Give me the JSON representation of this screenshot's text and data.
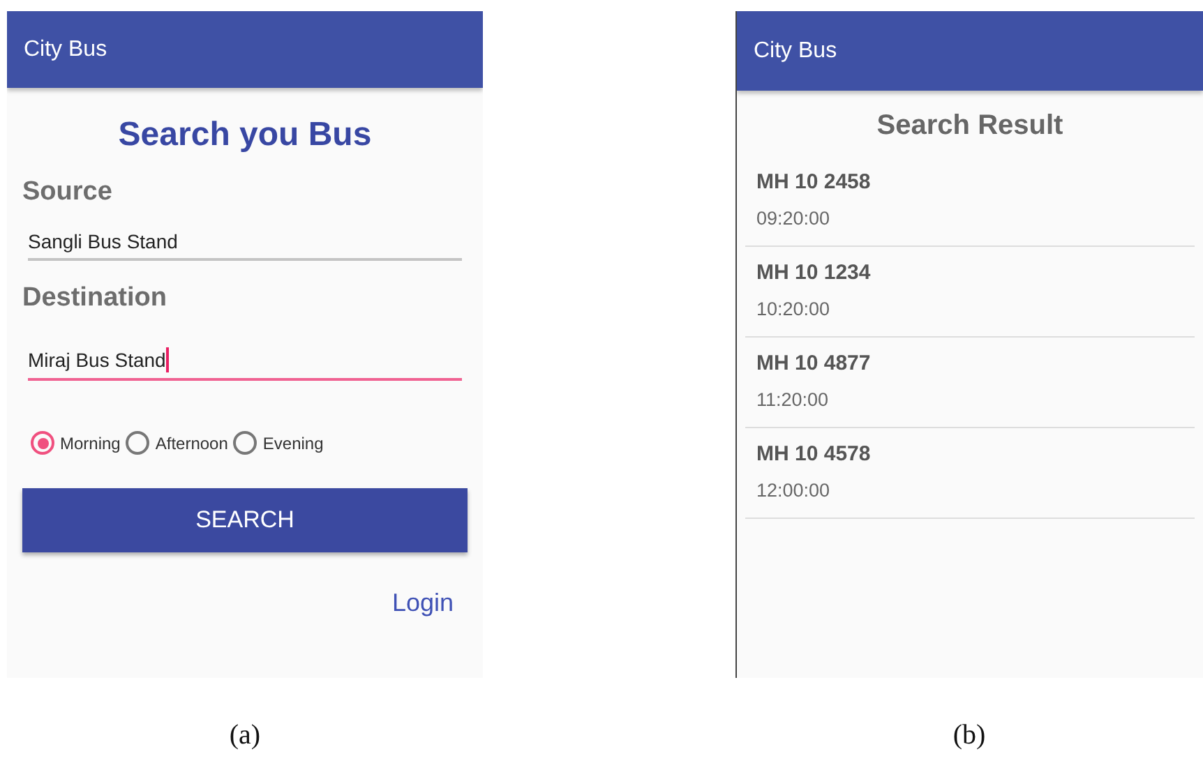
{
  "panels": [
    {
      "kind": "search",
      "app_bar": {
        "title": "City Bus"
      },
      "heading": "Search you Bus",
      "fields": [
        {
          "label": "Source",
          "value": "Sangli Bus Stand",
          "focused": false
        },
        {
          "label": "Destination",
          "value": "Miraj Bus Stand",
          "focused": true
        }
      ],
      "radios": [
        {
          "label": "Morning",
          "selected": true
        },
        {
          "label": "Afternoon",
          "selected": false
        },
        {
          "label": "Evening",
          "selected": false
        }
      ],
      "button": "SEARCH",
      "link": "Login",
      "caption": "(a)"
    },
    {
      "kind": "results",
      "app_bar": {
        "title": "City Bus"
      },
      "heading": "Search Result",
      "results": [
        {
          "bus": "MH 10 2458",
          "time": "09:20:00"
        },
        {
          "bus": "MH 10 1234",
          "time": "10:20:00"
        },
        {
          "bus": "MH 10 4877",
          "time": "11:20:00"
        },
        {
          "bus": "MH 10 4578",
          "time": "12:00:00"
        }
      ],
      "caption": "(b)"
    }
  ]
}
